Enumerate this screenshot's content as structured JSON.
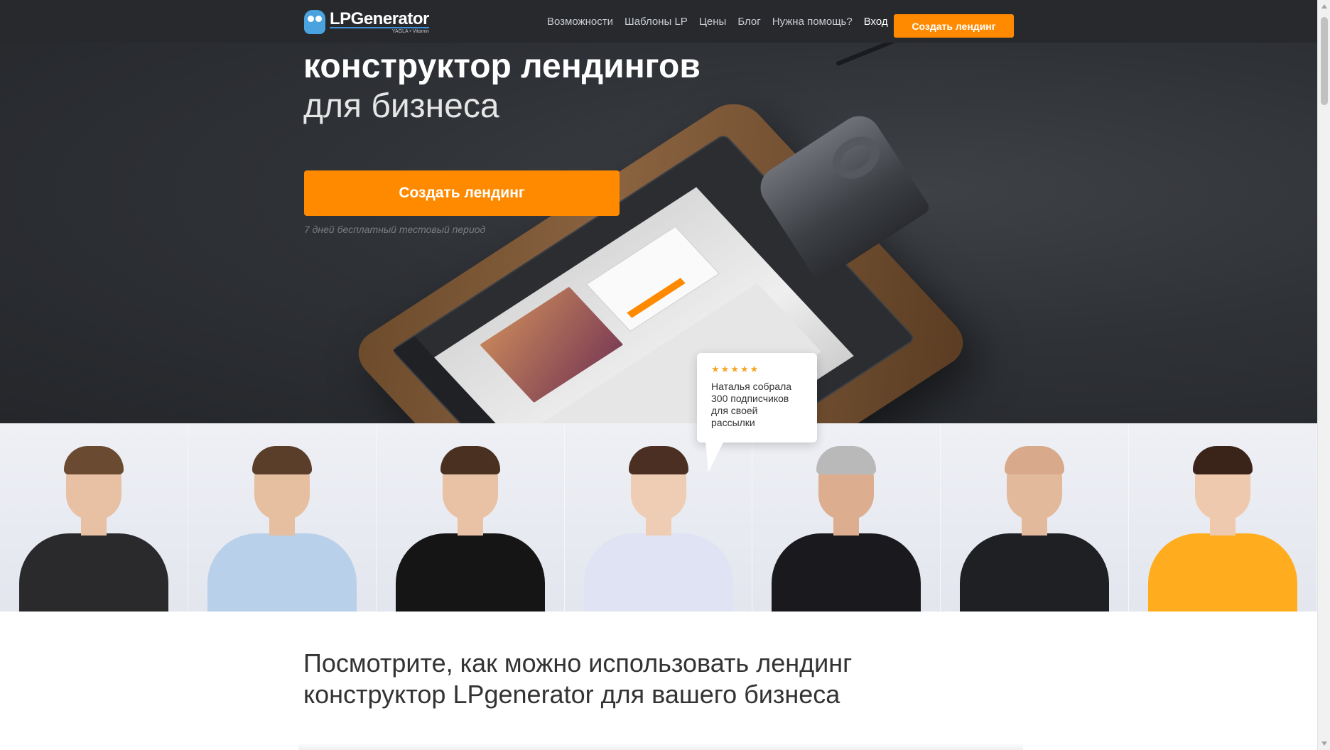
{
  "header": {
    "logo_text": "LPGenerator",
    "logo_sub": "YAGLA • Vitamin",
    "nav": [
      {
        "label": "Возможности"
      },
      {
        "label": "Шаблоны LP"
      },
      {
        "label": "Цены"
      },
      {
        "label": "Блог"
      },
      {
        "label": "Нужна помощь?"
      },
      {
        "label": "Вход"
      }
    ],
    "cta_label": "Создать лендинг"
  },
  "hero": {
    "title_bold": "конструктор лендингов",
    "title_light": "для бизнеса",
    "cta_label": "Создать лендинг",
    "trial_note": "7 дней бесплатный тестовый период"
  },
  "review": {
    "stars": 5,
    "text": "Наталья собрала 300 подписчиков для своей рассылки"
  },
  "people": [
    {
      "name": "person-1",
      "skin": "#e8c0a4",
      "hair": "#6b4a32",
      "body": "#2a2a2d"
    },
    {
      "name": "person-2",
      "skin": "#e6bea0",
      "hair": "#5a3e2a",
      "body": "#b9d0ea"
    },
    {
      "name": "person-3",
      "skin": "#e9c2a6",
      "hair": "#4a3020",
      "body": "#151515"
    },
    {
      "name": "person-4",
      "skin": "#efcdb4",
      "hair": "#4b2f22",
      "body": "#dfe3f4"
    },
    {
      "name": "person-5",
      "skin": "#dcae8f",
      "hair": "#b9b9b9",
      "body": "#1a1a1e"
    },
    {
      "name": "person-6",
      "skin": "#e3b99c",
      "hair": "#d8a98a",
      "body": "#1f2024"
    },
    {
      "name": "person-7",
      "skin": "#efc9ad",
      "hair": "#3a2318",
      "body": "#ffad1f"
    }
  ],
  "section": {
    "heading_line1": "Посмотрите, как можно использовать лендинг",
    "heading_line2": "конструктор LPgenerator для вашего бизнеса"
  },
  "colors": {
    "accent": "#ff8a00",
    "header_bg": "#27292d",
    "star": "#f5a623"
  }
}
